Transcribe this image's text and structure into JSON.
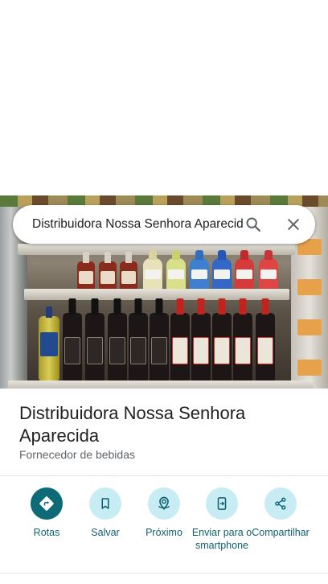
{
  "search": {
    "query": "Distribuidora Nossa Senhora Aparecida"
  },
  "place": {
    "name": "Distribuidora Nossa Senhora Aparecida",
    "category": "Fornecedor de bebidas"
  },
  "actions": [
    {
      "label": "Rotas",
      "icon": "directions-icon"
    },
    {
      "label": "Salvar",
      "icon": "bookmark-icon"
    },
    {
      "label": "Próximo",
      "icon": "nearby-icon"
    },
    {
      "label": "Enviar para o smartphone",
      "icon": "send-to-phone-icon"
    },
    {
      "label": "Compartilhar",
      "icon": "share-icon"
    }
  ],
  "colors": {
    "accent": "#0d6b78",
    "action_bg": "#c7ecf4",
    "action_text": "#0e5f6e"
  }
}
